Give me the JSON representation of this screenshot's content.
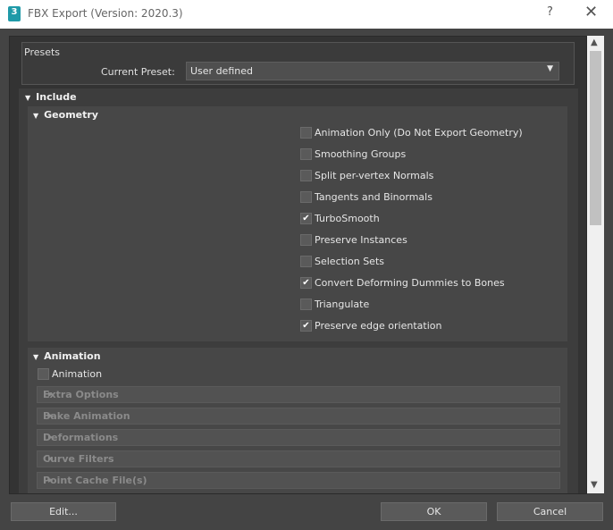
{
  "window": {
    "app_icon_text": "3",
    "title": "FBX Export (Version: 2020.3)",
    "help_label": "?",
    "close_label": "✕"
  },
  "presets": {
    "group_label": "Presets",
    "current_preset_label": "Current Preset:",
    "current_preset_value": "User defined",
    "dropdown_arrow": "▼"
  },
  "include": {
    "title": "Include",
    "geometry": {
      "title": "Geometry",
      "options": [
        {
          "label": "Animation Only (Do Not Export Geometry)",
          "checked": false
        },
        {
          "label": "Smoothing Groups",
          "checked": false
        },
        {
          "label": "Split per-vertex Normals",
          "checked": false
        },
        {
          "label": "Tangents and Binormals",
          "checked": false
        },
        {
          "label": "TurboSmooth",
          "checked": true
        },
        {
          "label": "Preserve Instances",
          "checked": false
        },
        {
          "label": "Selection Sets",
          "checked": false
        },
        {
          "label": "Convert Deforming Dummies to Bones",
          "checked": true
        },
        {
          "label": "Triangulate",
          "checked": false
        },
        {
          "label": "Preserve edge orientation",
          "checked": true
        }
      ]
    },
    "animation": {
      "title": "Animation",
      "checkbox_label": "Animation",
      "checked": false,
      "sections": [
        "Extra Options",
        "Bake Animation",
        "Deformations",
        "Curve Filters",
        "Point Cache File(s)"
      ]
    }
  },
  "buttons": {
    "edit": "Edit...",
    "ok": "OK",
    "cancel": "Cancel"
  },
  "scrollbar": {
    "up_arrow": "▲",
    "down_arrow": "▼"
  }
}
